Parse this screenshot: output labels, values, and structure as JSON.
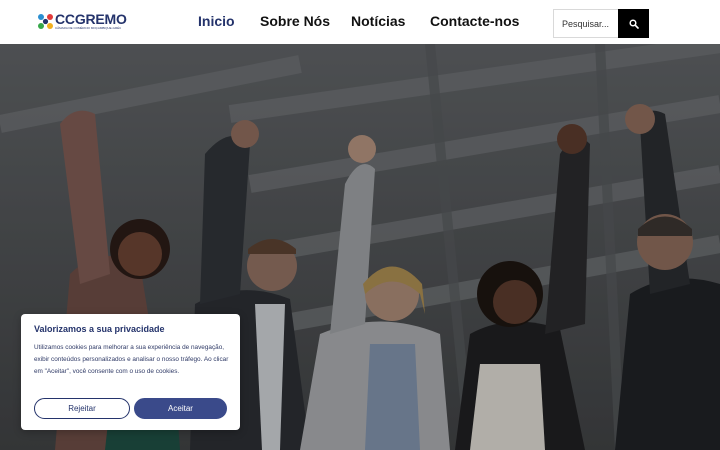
{
  "brand": {
    "logo_text": "CCGREMO",
    "logo_subtitle": "CÂMARA DE COMÉRCIO MOÇAMBIQUE-GRÉCIA",
    "primary_color": "#24336b",
    "accent_color": "#3a4a8a"
  },
  "nav": {
    "items": [
      {
        "label": "Inicio",
        "active": true
      },
      {
        "label": "Sobre Nós",
        "active": false
      },
      {
        "label": "Notícias",
        "active": false
      },
      {
        "label": "Contacte-nos",
        "active": false
      }
    ]
  },
  "search": {
    "placeholder": "Pesquisar...",
    "icon": "search-icon"
  },
  "hero": {
    "image": "group of business people raising fists in celebration"
  },
  "cookie_banner": {
    "title": "Valorizamos a sua privacidade",
    "text": "Utilizamos cookies para melhorar a sua experiência de navegação, exibir conteúdos personalizados e analisar o nosso tráfego. Ao clicar em \"Aceitar\", você consente com o uso de cookies.",
    "reject_label": "Rejeitar",
    "accept_label": "Aceitar"
  }
}
